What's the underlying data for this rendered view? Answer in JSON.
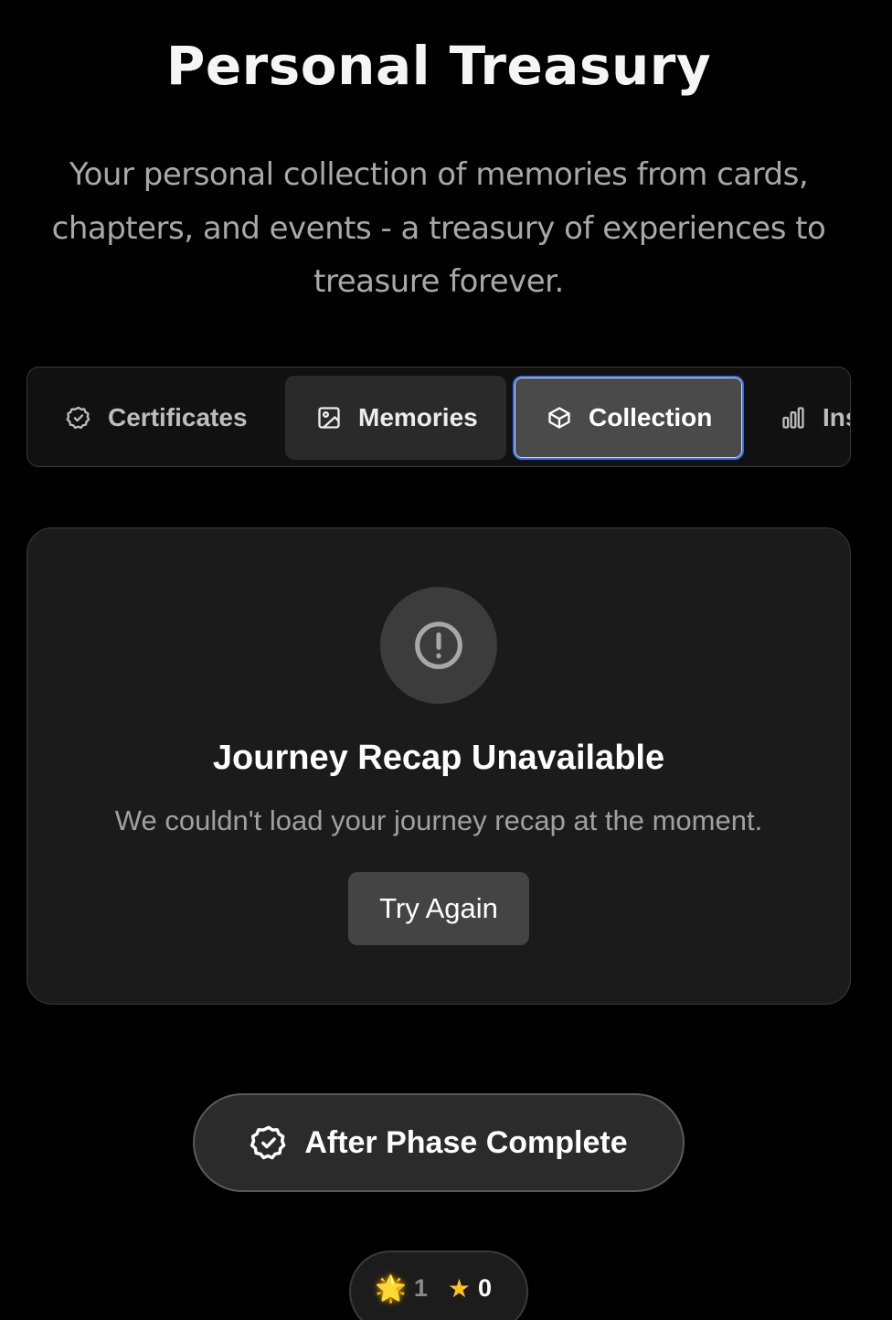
{
  "header": {
    "title": "Personal Treasury",
    "subtitle": "Your personal collection of memories from cards, chapters, and events - a treasury of experiences to treasure forever."
  },
  "tabs": [
    {
      "label": "Certificates",
      "icon": "badge-check-icon",
      "state": "inactive"
    },
    {
      "label": "Memories",
      "icon": "image-icon",
      "state": "hover"
    },
    {
      "label": "Collection",
      "icon": "box-icon",
      "state": "selected"
    },
    {
      "label": "Insights",
      "icon": "bar-chart-icon",
      "state": "inactive"
    }
  ],
  "error_card": {
    "icon": "alert-circle-icon",
    "title": "Journey Recap Unavailable",
    "message": "We couldn't load your journey recap at the moment.",
    "retry_label": "Try Again"
  },
  "phase_button": {
    "icon": "badge-check-icon",
    "label": "After Phase Complete"
  },
  "counters": [
    {
      "icon": "glowing-star-icon",
      "glyph": "🌟",
      "value": "1"
    },
    {
      "icon": "star-icon",
      "glyph": "★",
      "value": "0"
    }
  ],
  "colors": {
    "background": "#000000",
    "card": "#1b1b1b",
    "selected_tab": "#4a4a4a",
    "focus_ring": "#3b6fe0",
    "star": "#ffc21a"
  }
}
